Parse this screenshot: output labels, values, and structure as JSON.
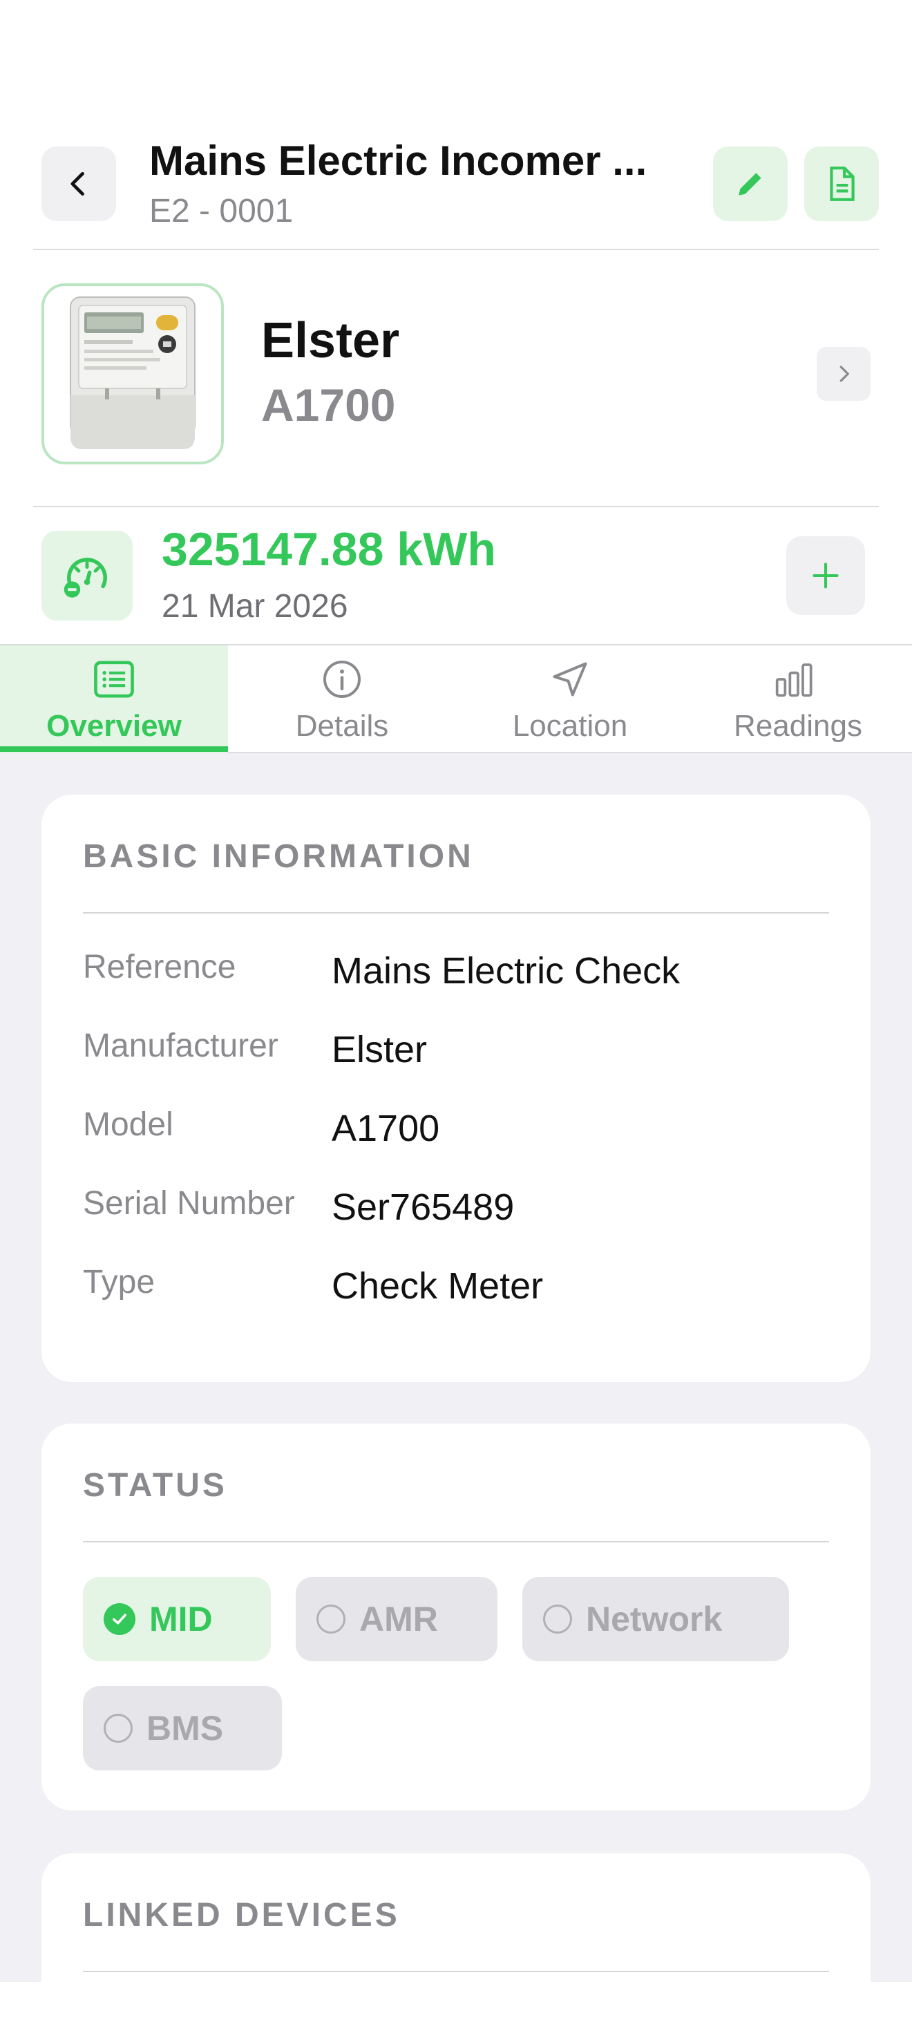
{
  "header": {
    "title": "Mains Electric Incomer ...",
    "subtitle": "E2 - 0001",
    "back_icon": "chevron-left-icon",
    "edit_icon": "pencil-icon",
    "document_icon": "document-icon"
  },
  "device": {
    "manufacturer": "Elster",
    "model": "A1700"
  },
  "reading": {
    "value": "325147.88 kWh",
    "date": "21 Mar 2026"
  },
  "tabs": [
    {
      "label": "Overview",
      "icon": "list-icon",
      "active": true
    },
    {
      "label": "Details",
      "icon": "info-icon",
      "active": false
    },
    {
      "label": "Location",
      "icon": "location-arrow-icon",
      "active": false
    },
    {
      "label": "Readings",
      "icon": "bar-chart-icon",
      "active": false
    }
  ],
  "basic_info": {
    "title": "BASIC INFORMATION",
    "rows": [
      {
        "label": "Reference",
        "value": "Mains Electric Check"
      },
      {
        "label": "Manufacturer",
        "value": "Elster"
      },
      {
        "label": "Model",
        "value": "A1700"
      },
      {
        "label": "Serial Number",
        "value": "Ser765489"
      },
      {
        "label": "Type",
        "value": "Check Meter"
      }
    ]
  },
  "status": {
    "title": "STATUS",
    "chips": [
      {
        "label": "MID",
        "checked": true
      },
      {
        "label": "AMR",
        "checked": false
      },
      {
        "label": "Network",
        "checked": false
      },
      {
        "label": "BMS",
        "checked": false
      }
    ]
  },
  "linked_devices": {
    "title": "LINKED DEVICES"
  },
  "colors": {
    "accent": "#34c759",
    "accent_bg": "#e4f5e6",
    "muted": "#8a8a8e",
    "background": "#f0f0f5"
  }
}
